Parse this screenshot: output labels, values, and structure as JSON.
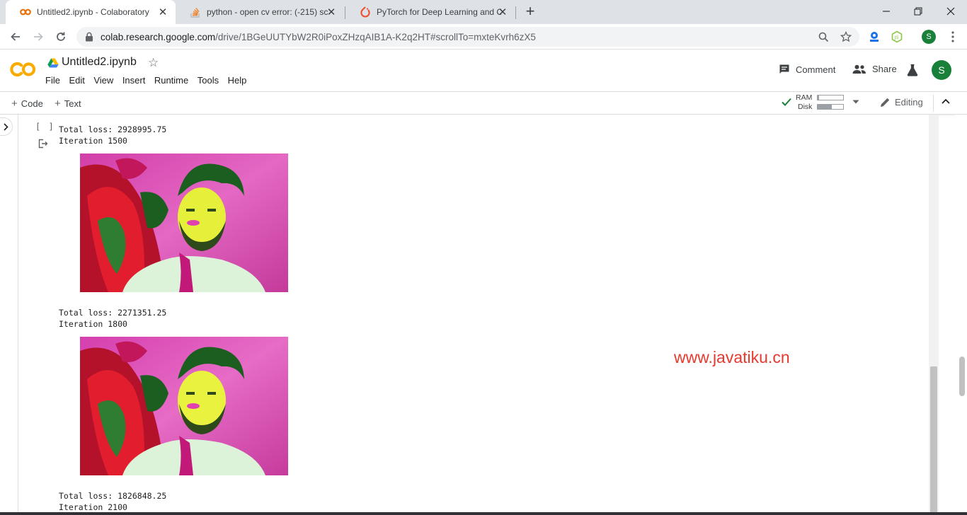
{
  "browser": {
    "tabs": [
      {
        "title": "Untitled2.ipynb - Colaboratory",
        "icon": "colab-icon",
        "active": true
      },
      {
        "title": "python - open cv error: (-215) sc",
        "icon": "stackoverflow-icon",
        "active": false
      },
      {
        "title": "PyTorch for Deep Learning and C",
        "icon": "pytorch-icon",
        "active": false
      }
    ],
    "address": {
      "host": "colab.research.google.com",
      "path": "/drive/1BGeUUTYbW2R0iPoxZHzqAIB1A-K2q2HT#scrollTo=mxteKvrh6zX5"
    },
    "profile_initial": "S"
  },
  "colab": {
    "notebook_title": "Untitled2.ipynb",
    "menu": [
      "File",
      "Edit",
      "View",
      "Insert",
      "Runtime",
      "Tools",
      "Help"
    ],
    "comment_label": "Comment",
    "share_label": "Share",
    "profile_initial": "S",
    "add_code_label": "Code",
    "add_text_label": "Text",
    "ram_label": "RAM",
    "disk_label": "Disk",
    "ram_usage": 0.05,
    "disk_usage": 0.55,
    "mode_label": "Editing"
  },
  "cell": {
    "run_indicator": "[ ]",
    "outputs": [
      {
        "loss": "Total loss: 2928995.75",
        "iteration": "Iteration 1500"
      },
      {
        "loss": "Total loss: 2271351.25",
        "iteration": "Iteration 1800"
      },
      {
        "loss": "Total loss: 1826848.25",
        "iteration": "Iteration 2100"
      }
    ]
  },
  "watermark": "www.javatiku.cn",
  "colors": {
    "colab_orange": "#f9ab00",
    "watermark_red": "#e8392f",
    "avatar_green": "#188038"
  }
}
